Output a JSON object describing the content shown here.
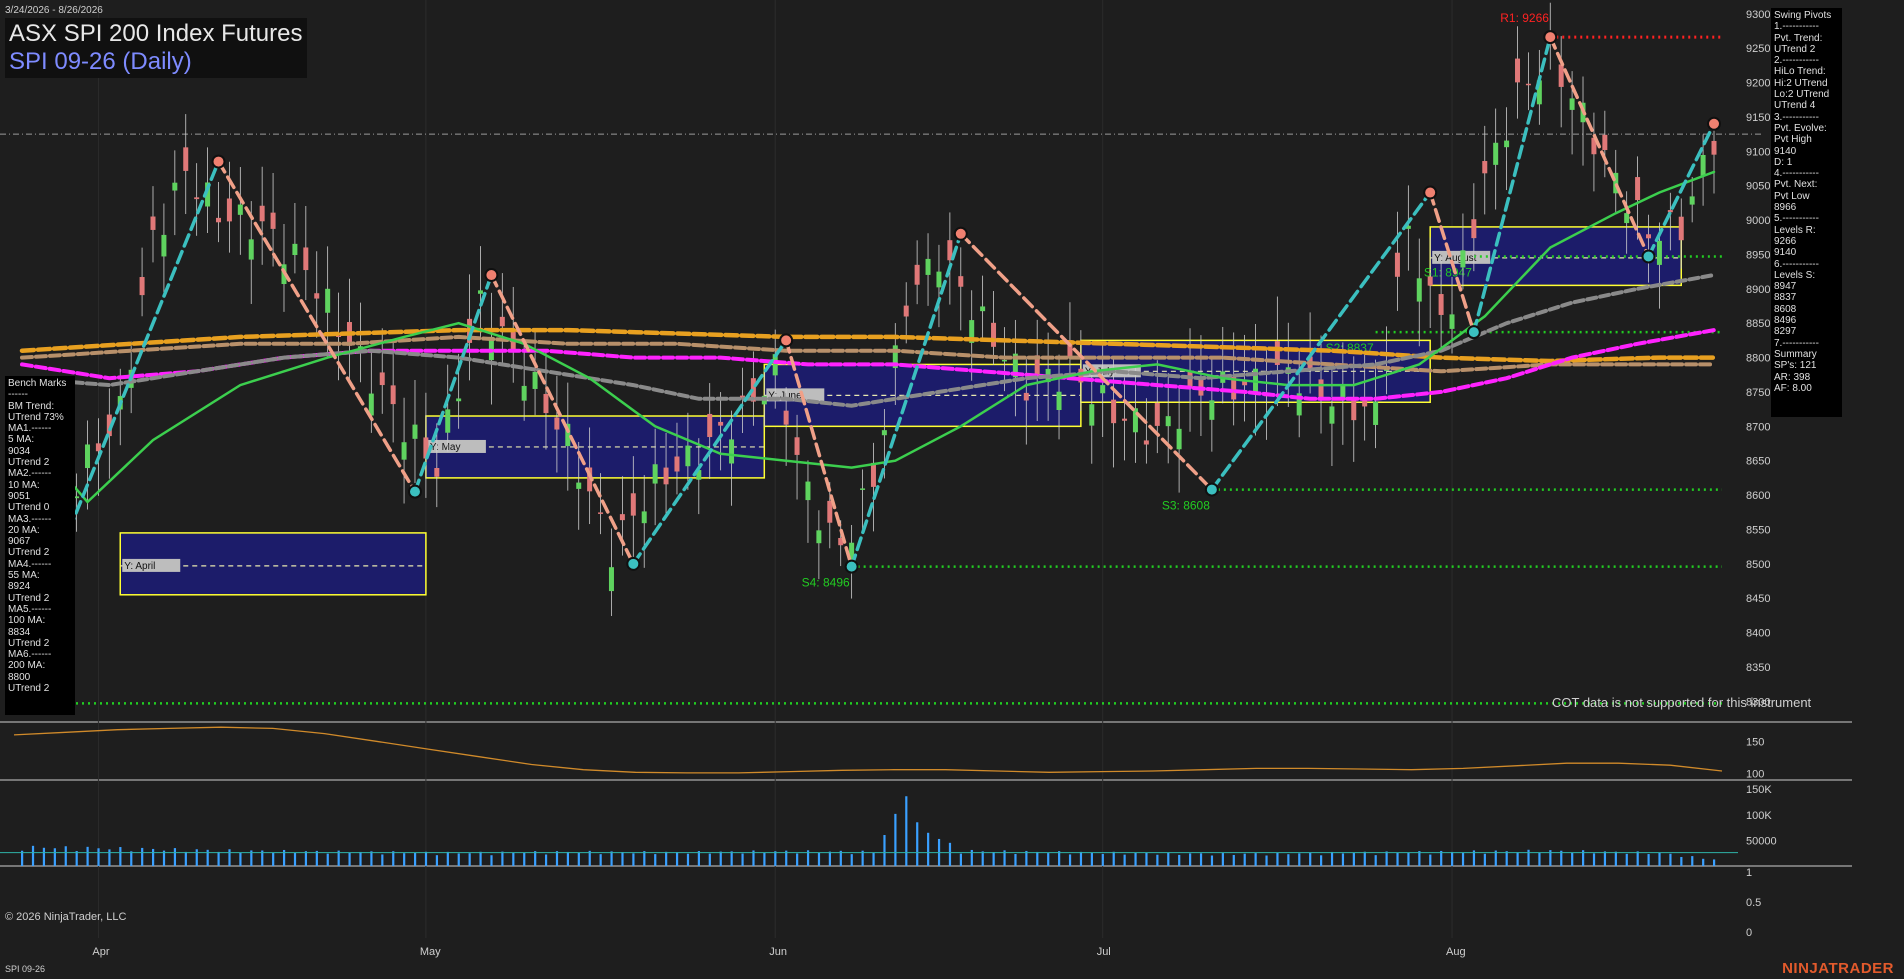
{
  "header": {
    "date_range": "3/24/2026 - 8/26/2026",
    "title": "ASX SPI 200 Index Futures",
    "subtitle": "SPI 09-26 (Daily)"
  },
  "left_panel": {
    "lines": [
      "Bench Marks",
      "------",
      "BM Trend:",
      "UTrend 73%",
      "MA1.------",
      "5 MA:",
      "9034",
      "UTrend 2",
      "MA2.------",
      "10 MA:",
      "9051",
      "UTrend 0",
      "MA3.------",
      "20 MA:",
      "9067",
      "UTrend 2",
      "MA4.------",
      "55 MA:",
      "8924",
      "UTrend 2",
      "MA5.------",
      "100 MA:",
      "8834",
      "UTrend 2",
      "MA6.------",
      "200 MA:",
      "8800",
      "UTrend 2"
    ]
  },
  "right_panel": {
    "lines": [
      "Swing Pivots",
      "1.-----------",
      "Pvt. Trend:",
      "UTrend 2",
      "2.-----------",
      "HiLo Trend:",
      "Hi:2 UTrend",
      "Lo:2 UTrend",
      "UTrend 4",
      "3.-----------",
      "Pvt. Evolve:",
      "Pvt High",
      "9140",
      "D: 1",
      "4.-----------",
      "Pvt. Next:",
      "Pvt Low",
      "8966",
      "5.-----------",
      "Levels R:",
      "9266",
      "9140",
      "6.-----------",
      "Levels S:",
      "8947",
      "8837",
      "8608",
      "8496",
      "8297",
      "7.-----------",
      "Summary",
      "SP's: 121",
      "AR: 398",
      "AF: 8.00"
    ]
  },
  "footer": {
    "copyright": "© 2026 NinjaTrader, LLC",
    "symbol": "SPI 09-26",
    "brand": "NINJATRADER",
    "cot_note": "COT data is not supported for this instrument"
  },
  "colors": {
    "background": "#1e1e1e",
    "up_candle": "#5fd35f",
    "down_candle": "#e07878",
    "ma_green": "#3ccf4e",
    "ma_gray": "#8a8a8a",
    "ma_magenta": "#ff22ff",
    "ma_orange": "#e8a020",
    "ma_tan": "#b8906a",
    "swing_up": "#3bbfbf",
    "swing_down": "#f0a088",
    "resistance": "#ff2222",
    "support": "#22cc22",
    "box_border": "#ffff33",
    "box_fill": "#1c1c6a",
    "volume": "#3aa0ff"
  },
  "chart_data": [
    {
      "type": "candlestick",
      "ylim": [
        8270,
        9320
      ],
      "y_ticks": [
        8300,
        8350,
        8400,
        8450,
        8500,
        8550,
        8600,
        8650,
        8700,
        8750,
        8800,
        8850,
        8900,
        8950,
        9000,
        9050,
        9100,
        9150,
        9200,
        9250,
        9300
      ],
      "x_labels": [
        {
          "label": "Apr",
          "day": 7
        },
        {
          "label": "May",
          "day": 37
        },
        {
          "label": "Jun",
          "day": 69
        },
        {
          "label": "Jul",
          "day": 99
        },
        {
          "label": "Aug",
          "day": 131
        }
      ],
      "day_count": 156,
      "candle_keys": [
        {
          "day": 0,
          "close": 8380
        },
        {
          "day": 3,
          "close": 8560
        },
        {
          "day": 6,
          "close": 8650
        },
        {
          "day": 9,
          "close": 8720
        },
        {
          "day": 12,
          "close": 8970
        },
        {
          "day": 15,
          "close": 9070
        },
        {
          "day": 18,
          "close": 9010
        },
        {
          "day": 22,
          "close": 8990
        },
        {
          "day": 26,
          "close": 8930
        },
        {
          "day": 30,
          "close": 8820
        },
        {
          "day": 35,
          "close": 8700
        },
        {
          "day": 38,
          "close": 8640
        },
        {
          "day": 42,
          "close": 8880
        },
        {
          "day": 46,
          "close": 8780
        },
        {
          "day": 50,
          "close": 8680
        },
        {
          "day": 54,
          "close": 8520
        },
        {
          "day": 58,
          "close": 8620
        },
        {
          "day": 62,
          "close": 8660
        },
        {
          "day": 66,
          "close": 8720
        },
        {
          "day": 69,
          "close": 8780
        },
        {
          "day": 72,
          "close": 8600
        },
        {
          "day": 75,
          "close": 8520
        },
        {
          "day": 78,
          "close": 8620
        },
        {
          "day": 81,
          "close": 8880
        },
        {
          "day": 84,
          "close": 8950
        },
        {
          "day": 88,
          "close": 8850
        },
        {
          "day": 92,
          "close": 8760
        },
        {
          "day": 96,
          "close": 8780
        },
        {
          "day": 100,
          "close": 8720
        },
        {
          "day": 104,
          "close": 8690
        },
        {
          "day": 108,
          "close": 8750
        },
        {
          "day": 112,
          "close": 8760
        },
        {
          "day": 116,
          "close": 8780
        },
        {
          "day": 120,
          "close": 8740
        },
        {
          "day": 124,
          "close": 8720
        },
        {
          "day": 127,
          "close": 8990
        },
        {
          "day": 129,
          "close": 8880
        },
        {
          "day": 131,
          "close": 8870
        },
        {
          "day": 134,
          "close": 9060
        },
        {
          "day": 137,
          "close": 9180
        },
        {
          "day": 140,
          "close": 9240
        },
        {
          "day": 143,
          "close": 9150
        },
        {
          "day": 146,
          "close": 9060
        },
        {
          "day": 149,
          "close": 8980
        },
        {
          "day": 152,
          "close": 8990
        },
        {
          "day": 155,
          "close": 9120
        }
      ],
      "moving_averages": [
        {
          "name": "5 MA",
          "color_key": "ma_green",
          "points": [
            [
              0,
              8700
            ],
            [
              6,
              8590
            ],
            [
              12,
              8680
            ],
            [
              20,
              8760
            ],
            [
              28,
              8800
            ],
            [
              35,
              8830
            ],
            [
              40,
              8850
            ],
            [
              46,
              8820
            ],
            [
              52,
              8770
            ],
            [
              58,
              8700
            ],
            [
              64,
              8660
            ],
            [
              70,
              8650
            ],
            [
              76,
              8640
            ],
            [
              80,
              8650
            ],
            [
              86,
              8700
            ],
            [
              92,
              8760
            ],
            [
              98,
              8780
            ],
            [
              104,
              8790
            ],
            [
              110,
              8770
            ],
            [
              116,
              8760
            ],
            [
              122,
              8760
            ],
            [
              128,
              8790
            ],
            [
              134,
              8860
            ],
            [
              140,
              8960
            ],
            [
              146,
              9010
            ],
            [
              150,
              9040
            ],
            [
              155,
              9070
            ]
          ]
        },
        {
          "name": "20 MA",
          "color_key": "ma_gray",
          "points": [
            [
              0,
              8770
            ],
            [
              8,
              8760
            ],
            [
              16,
              8780
            ],
            [
              24,
              8800
            ],
            [
              32,
              8810
            ],
            [
              40,
              8800
            ],
            [
              48,
              8780
            ],
            [
              56,
              8760
            ],
            [
              62,
              8740
            ],
            [
              70,
              8740
            ],
            [
              76,
              8730
            ],
            [
              84,
              8750
            ],
            [
              92,
              8770
            ],
            [
              100,
              8780
            ],
            [
              108,
              8770
            ],
            [
              116,
              8780
            ],
            [
              124,
              8790
            ],
            [
              130,
              8810
            ],
            [
              136,
              8850
            ],
            [
              142,
              8880
            ],
            [
              148,
              8900
            ],
            [
              155,
              8920
            ]
          ]
        },
        {
          "name": "55 MA",
          "color_key": "ma_magenta",
          "points": [
            [
              0,
              8790
            ],
            [
              8,
              8770
            ],
            [
              16,
              8780
            ],
            [
              24,
              8800
            ],
            [
              32,
              8810
            ],
            [
              40,
              8810
            ],
            [
              48,
              8810
            ],
            [
              56,
              8800
            ],
            [
              64,
              8800
            ],
            [
              72,
              8790
            ],
            [
              80,
              8790
            ],
            [
              88,
              8780
            ],
            [
              96,
              8770
            ],
            [
              104,
              8760
            ],
            [
              112,
              8750
            ],
            [
              118,
              8740
            ],
            [
              124,
              8740
            ],
            [
              130,
              8750
            ],
            [
              136,
              8770
            ],
            [
              142,
              8800
            ],
            [
              148,
              8820
            ],
            [
              155,
              8840
            ]
          ]
        },
        {
          "name": "100 MA",
          "color_key": "ma_tan",
          "points": [
            [
              0,
              8800
            ],
            [
              10,
              8810
            ],
            [
              20,
              8820
            ],
            [
              30,
              8820
            ],
            [
              40,
              8830
            ],
            [
              50,
              8820
            ],
            [
              60,
              8820
            ],
            [
              70,
              8810
            ],
            [
              80,
              8810
            ],
            [
              90,
              8800
            ],
            [
              100,
              8800
            ],
            [
              110,
              8800
            ],
            [
              120,
              8790
            ],
            [
              130,
              8780
            ],
            [
              140,
              8790
            ],
            [
              150,
              8790
            ],
            [
              155,
              8790
            ]
          ]
        },
        {
          "name": "200 MA",
          "color_key": "ma_orange",
          "points": [
            [
              0,
              8810
            ],
            [
              10,
              8820
            ],
            [
              20,
              8830
            ],
            [
              30,
              8835
            ],
            [
              40,
              8840
            ],
            [
              50,
              8840
            ],
            [
              60,
              8835
            ],
            [
              70,
              8830
            ],
            [
              80,
              8830
            ],
            [
              90,
              8825
            ],
            [
              100,
              8820
            ],
            [
              110,
              8815
            ],
            [
              120,
              8810
            ],
            [
              130,
              8800
            ],
            [
              140,
              8795
            ],
            [
              150,
              8800
            ],
            [
              155,
              8800
            ]
          ]
        }
      ],
      "swing_points": [
        {
          "day": 0,
          "price": 8380,
          "kind": "low"
        },
        {
          "day": 18,
          "price": 9085,
          "kind": "high"
        },
        {
          "day": 36,
          "price": 8605,
          "kind": "low"
        },
        {
          "day": 43,
          "price": 8920,
          "kind": "high"
        },
        {
          "day": 56,
          "price": 8500,
          "kind": "low"
        },
        {
          "day": 70,
          "price": 8825,
          "kind": "high"
        },
        {
          "day": 76,
          "price": 8496,
          "kind": "low"
        },
        {
          "day": 86,
          "price": 8980,
          "kind": "high"
        },
        {
          "day": 109,
          "price": 8608,
          "kind": "low"
        },
        {
          "day": 129,
          "price": 9040,
          "kind": "high"
        },
        {
          "day": 133,
          "price": 8837,
          "kind": "low"
        },
        {
          "day": 140,
          "price": 9266,
          "kind": "high"
        },
        {
          "day": 149,
          "price": 8947,
          "kind": "low"
        },
        {
          "day": 155,
          "price": 9140,
          "kind": "high"
        }
      ],
      "levels": [
        {
          "label": "R1: 9266",
          "price": 9266,
          "from_day": 140,
          "to_day": 155,
          "kind": "resistance"
        },
        {
          "label": "S1: 8947",
          "price": 8947,
          "from_day": 133,
          "to_day": 155,
          "kind": "support"
        },
        {
          "label": "S2: 8837",
          "price": 8837,
          "from_day": 124,
          "to_day": 155,
          "kind": "support"
        },
        {
          "label": "S3: 8608",
          "price": 8608,
          "from_day": 109,
          "to_day": 155,
          "kind": "support"
        },
        {
          "label": "S4: 8496",
          "price": 8496,
          "from_day": 76,
          "to_day": 155,
          "kind": "support"
        },
        {
          "label": "",
          "price": 8297,
          "from_day": 0,
          "to_day": 155,
          "kind": "support"
        }
      ],
      "value_areas": [
        {
          "label": "Y: April",
          "from_day": 9,
          "to_day": 37,
          "low": 8455,
          "high": 8545,
          "mid": 8497
        },
        {
          "label": "Y: May",
          "from_day": 37,
          "to_day": 68,
          "low": 8625,
          "high": 8715,
          "mid": 8670
        },
        {
          "label": "Y: June",
          "from_day": 68,
          "to_day": 97,
          "low": 8700,
          "high": 8790,
          "mid": 8745
        },
        {
          "label": "Y: July",
          "from_day": 97,
          "to_day": 129,
          "low": 8735,
          "high": 8825,
          "mid": 8780
        },
        {
          "label": "Y: August",
          "from_day": 129,
          "to_day": 152,
          "low": 8905,
          "high": 8990,
          "mid": 8945
        }
      ],
      "price_reference": 9125
    },
    {
      "type": "line",
      "ylim": [
        90,
        180
      ],
      "y_ticks": [
        150,
        100
      ],
      "values": [
        160,
        164,
        168,
        170,
        172,
        170,
        162,
        150,
        138,
        126,
        114,
        106,
        102,
        101,
        101,
        103,
        105,
        106,
        106,
        104,
        102,
        103,
        104,
        106,
        108,
        108,
        107,
        106,
        108,
        112,
        116,
        116,
        113,
        104
      ]
    },
    {
      "type": "bar",
      "ylim": [
        0,
        160000
      ],
      "y_ticks": [
        150000,
        100000,
        50000
      ],
      "y_tick_labels": [
        "150K",
        "100K",
        "50000"
      ],
      "volume_keys": [
        {
          "day": 0,
          "value": 35000
        },
        {
          "day": 10,
          "value": 32000
        },
        {
          "day": 20,
          "value": 28000
        },
        {
          "day": 30,
          "value": 26000
        },
        {
          "day": 40,
          "value": 24000
        },
        {
          "day": 50,
          "value": 26000
        },
        {
          "day": 60,
          "value": 25000
        },
        {
          "day": 70,
          "value": 27000
        },
        {
          "day": 78,
          "value": 26000
        },
        {
          "day": 80,
          "value": 90000
        },
        {
          "day": 81,
          "value": 158000
        },
        {
          "day": 82,
          "value": 75000
        },
        {
          "day": 86,
          "value": 28000
        },
        {
          "day": 96,
          "value": 25000
        },
        {
          "day": 110,
          "value": 22000
        },
        {
          "day": 120,
          "value": 24000
        },
        {
          "day": 130,
          "value": 26000
        },
        {
          "day": 140,
          "value": 28000
        },
        {
          "day": 150,
          "value": 24000
        },
        {
          "day": 155,
          "value": 12000
        }
      ]
    },
    {
      "type": "line",
      "ylim": [
        -0.1,
        1.1
      ],
      "y_ticks": [
        1,
        0.5,
        0
      ],
      "y_tick_labels": [
        "1",
        "0.5",
        "0"
      ]
    }
  ]
}
